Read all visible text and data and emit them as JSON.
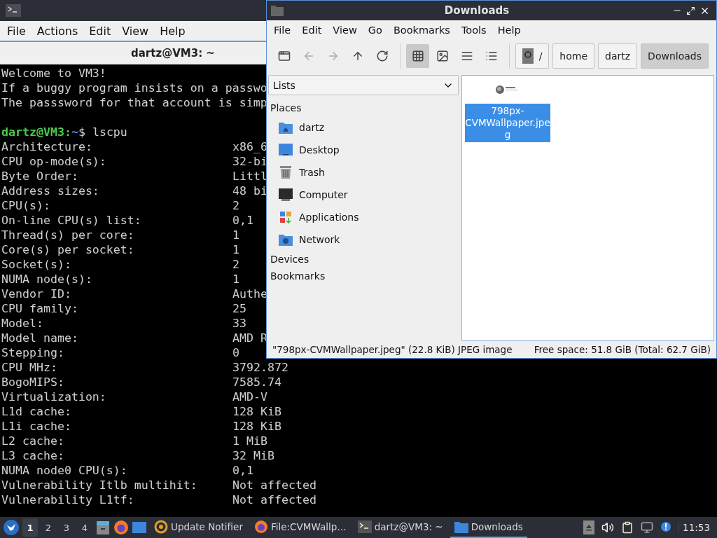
{
  "terminal": {
    "tab_title": "dartz@VM3: ~",
    "menu": [
      "File",
      "Actions",
      "Edit",
      "View",
      "Help"
    ],
    "intro": [
      "Welcome to VM3!",
      "If a buggy program insists on a passwo",
      "The passsword for that account is simp"
    ],
    "prompt": {
      "user": "dartz@VM3",
      "separator": ":",
      "path": "~",
      "command": "$ lscpu"
    },
    "rows": [
      {
        "label": "Architecture:",
        "value": "x86_6"
      },
      {
        "label": "CPU op-mode(s):",
        "value": "32-bi"
      },
      {
        "label": "Byte Order:",
        "value": "Littl"
      },
      {
        "label": "Address sizes:",
        "value": "48 bi"
      },
      {
        "label": "CPU(s):",
        "value": "2"
      },
      {
        "label": "On-line CPU(s) list:",
        "value": "0,1"
      },
      {
        "label": "Thread(s) per core:",
        "value": "1"
      },
      {
        "label": "Core(s) per socket:",
        "value": "1"
      },
      {
        "label": "Socket(s):",
        "value": "2"
      },
      {
        "label": "NUMA node(s):",
        "value": "1"
      },
      {
        "label": "Vendor ID:",
        "value": "Authe"
      },
      {
        "label": "CPU family:",
        "value": "25"
      },
      {
        "label": "Model:",
        "value": "33"
      },
      {
        "label": "Model name:",
        "value": "AMD R"
      },
      {
        "label": "Stepping:",
        "value": "0"
      },
      {
        "label": "CPU MHz:",
        "value": "3792.872"
      },
      {
        "label": "BogoMIPS:",
        "value": "7585.74"
      },
      {
        "label": "Virtualization:",
        "value": "AMD-V"
      },
      {
        "label": "L1d cache:",
        "value": "128 KiB"
      },
      {
        "label": "L1i cache:",
        "value": "128 KiB"
      },
      {
        "label": "L2 cache:",
        "value": "1 MiB"
      },
      {
        "label": "L3 cache:",
        "value": "32 MiB"
      },
      {
        "label": "NUMA node0 CPU(s):",
        "value": "0,1"
      },
      {
        "label": "Vulnerability Itlb multihit:",
        "value": "Not affected"
      },
      {
        "label": "Vulnerability L1tf:",
        "value": "Not affected"
      }
    ]
  },
  "file_manager": {
    "title": "Downloads",
    "menu": [
      "File",
      "Edit",
      "View",
      "Go",
      "Bookmarks",
      "Tools",
      "Help"
    ],
    "nav_buttons": [
      {
        "kind": "new-window",
        "disabled": false
      },
      {
        "kind": "back",
        "disabled": true
      },
      {
        "kind": "forward",
        "disabled": true
      },
      {
        "kind": "up",
        "disabled": false
      },
      {
        "kind": "reload",
        "disabled": false
      }
    ],
    "view_modes": [
      {
        "kind": "icons",
        "selected": true
      },
      {
        "kind": "thumbnails",
        "selected": false
      },
      {
        "kind": "compact",
        "selected": false
      },
      {
        "kind": "details",
        "selected": false
      }
    ],
    "path": [
      {
        "kind": "root",
        "label": "/",
        "selected": false
      },
      {
        "kind": "dir",
        "label": "home",
        "selected": false
      },
      {
        "kind": "dir",
        "label": "dartz",
        "selected": false
      },
      {
        "kind": "dir",
        "label": "Downloads",
        "selected": true
      }
    ],
    "side_pane": {
      "dropdown": "Lists",
      "sections": [
        {
          "title": "Places",
          "items": [
            {
              "kind": "home",
              "label": "dartz"
            },
            {
              "kind": "desktop",
              "label": "Desktop"
            },
            {
              "kind": "trash",
              "label": "Trash"
            },
            {
              "kind": "computer",
              "label": "Computer"
            },
            {
              "kind": "applications",
              "label": "Applications"
            },
            {
              "kind": "network",
              "label": "Network"
            }
          ]
        },
        {
          "title": "Devices"
        },
        {
          "title": "Bookmarks"
        }
      ]
    },
    "files": [
      {
        "name": "798px-CVMWallpaper.jpeg",
        "selected": true,
        "kind": "picture"
      }
    ],
    "status_left": "\"798px-CVMWallpaper.jpeg\" (22.8 KiB) JPEG image",
    "status_right": "Free space: 51.8 GiB (Total: 62.7 GiB)"
  },
  "taskbar": {
    "workspaces": [
      {
        "label": "1",
        "selected": true
      },
      {
        "label": "2",
        "selected": false
      },
      {
        "label": "3",
        "selected": false
      },
      {
        "label": "4",
        "selected": false
      }
    ],
    "tasks": [
      {
        "kind": "update",
        "label": "Update Notifier",
        "selected": false
      },
      {
        "kind": "firefox",
        "label": "File:CVMWallp…",
        "selected": false
      },
      {
        "kind": "terminal",
        "label": "dartz@VM3: ~",
        "selected": false
      },
      {
        "kind": "folder",
        "label": "Downloads",
        "selected": true
      }
    ],
    "clock": "11:53"
  }
}
